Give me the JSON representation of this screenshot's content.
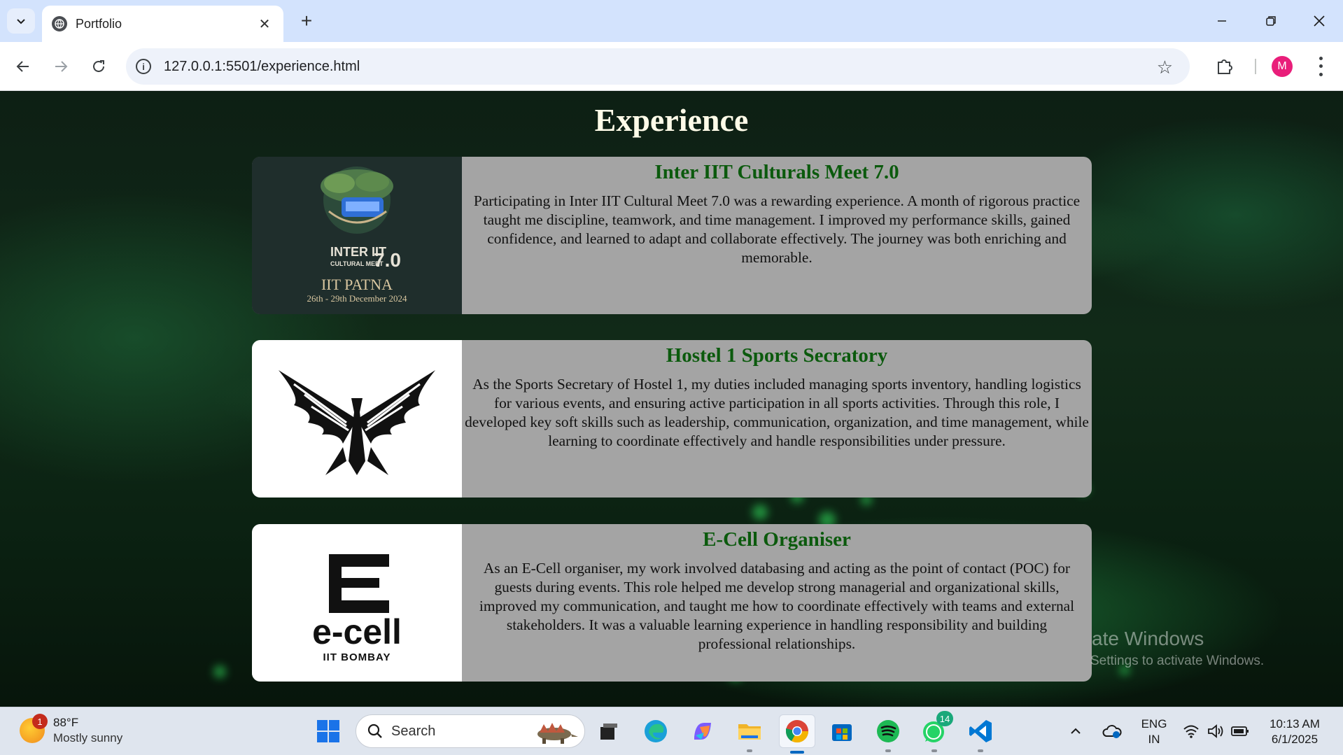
{
  "browser": {
    "tab_title": "Portfolio",
    "new_tab_symbol": "+",
    "url": "127.0.0.1:5501/experience.html",
    "profile_initial": "M"
  },
  "page": {
    "heading": "Experience",
    "cards": [
      {
        "title": "Inter IIT Culturals Meet 7.0",
        "text": "Participating in Inter IIT Cultural Meet 7.0 was a rewarding experience. A month of rigorous practice taught me discipline, teamwork, and time management. I improved my performance skills, gained confidence, and learned to adapt and collaborate effectively. The journey was both enriching and memorable.",
        "logo": {
          "line1": "INTER IIT",
          "line2": "CULTURAL MEET",
          "version": "7.0",
          "venue": "IIT PATNA",
          "dates": "26th - 29th December 2024"
        }
      },
      {
        "title": "Hostel 1 Sports Secratory",
        "text": "As the Sports Secretary of Hostel 1, my duties included managing sports inventory, handling logistics for various events, and ensuring active participation in all sports activities. Through this role, I developed key soft skills such as leadership, communication, organization, and time management, while learning to coordinate effectively and handle responsibilities under pressure."
      },
      {
        "title": "E-Cell Organiser",
        "text": "As an E-Cell organiser, my work involved databasing and acting as the point of contact (POC) for guests during events. This role helped me develop strong managerial and organizational skills, improved my communication, and taught me how to coordinate effectively with teams and external stakeholders. It was a valuable learning experience in handling responsibility and building professional relationships.",
        "logo": {
          "wordmark": "e-cell",
          "sub": "IIT BOMBAY"
        }
      }
    ],
    "watermark": {
      "line1": "ate Windows",
      "line2": "Settings to activate Windows."
    }
  },
  "taskbar": {
    "weather_badge": "1",
    "weather_temp": "88°F",
    "weather_desc": "Mostly sunny",
    "search_label": "Search",
    "whatsapp_badge": "14",
    "lang_top": "ENG",
    "lang_bottom": "IN",
    "time": "10:13 AM",
    "date": "6/1/2025"
  }
}
